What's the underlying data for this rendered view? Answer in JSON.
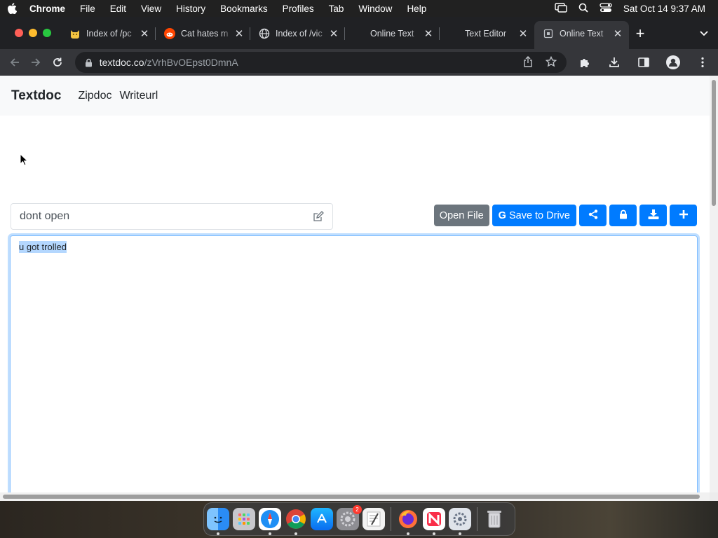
{
  "menubar": {
    "app": "Chrome",
    "items": [
      "File",
      "Edit",
      "View",
      "History",
      "Bookmarks",
      "Profiles",
      "Tab",
      "Window",
      "Help"
    ],
    "clock": "Sat Oct 14  9:37 AM",
    "status_icons": [
      "screen-mirroring-icon",
      "spotlight-search-icon",
      "control-center-icon"
    ]
  },
  "tabs": [
    {
      "title": "Index of /pc",
      "favicon": "cat-emoji-icon",
      "active": false
    },
    {
      "title": "Cat hates m",
      "favicon": "reddit-icon",
      "active": false
    },
    {
      "title": "Index of /vic",
      "favicon": "globe-icon",
      "active": false
    },
    {
      "title": "Online Text",
      "favicon": "blank-icon",
      "active": false
    },
    {
      "title": "Text Editor",
      "favicon": "blank-icon",
      "active": false
    },
    {
      "title": "Online Text",
      "favicon": "document-icon",
      "active": true
    }
  ],
  "address": {
    "domain": "textdoc.co",
    "path": "/zVrhBvOEpst0DmnA"
  },
  "site": {
    "brand": "Textdoc",
    "nav": [
      "Zipdoc",
      "Writeurl"
    ]
  },
  "document": {
    "title": "dont open",
    "content": "u got trolled"
  },
  "buttons": {
    "open_file": "Open File",
    "save_drive": "Save to Drive",
    "drive_glyph": "G",
    "icons": [
      "share-icon",
      "lock-icon",
      "download-icon",
      "plus-icon"
    ]
  },
  "dock": {
    "apps": [
      "Finder",
      "Launchpad",
      "Safari",
      "Chrome",
      "App Store",
      "System Preferences",
      "TextEdit",
      "Firefox",
      "News",
      "Settings",
      "Trash"
    ],
    "badge": "2"
  },
  "colors": {
    "primary": "#007bff",
    "secondary": "#6c757d",
    "selection": "#b4d7fe"
  }
}
